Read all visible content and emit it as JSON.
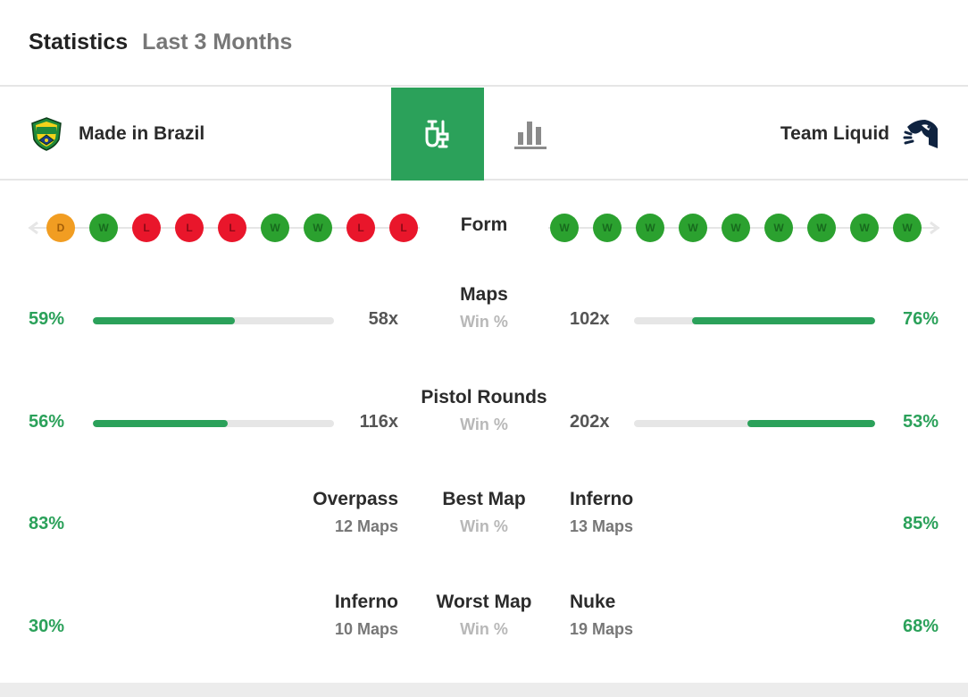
{
  "header": {
    "title": "Statistics",
    "subtitle": "Last 3 Months"
  },
  "teams": {
    "left": {
      "name": "Made in Brazil",
      "logo_icon": "mibr-shield-logo"
    },
    "right": {
      "name": "Team Liquid",
      "logo_icon": "liquid-horse-logo"
    }
  },
  "tabs": [
    {
      "icon": "compare-icon",
      "active": true
    },
    {
      "icon": "bar-chart-icon",
      "active": false
    }
  ],
  "form": {
    "label": "Form",
    "left": [
      "D",
      "W",
      "L",
      "L",
      "L",
      "W",
      "W",
      "L",
      "L"
    ],
    "right": [
      "W",
      "W",
      "W",
      "W",
      "W",
      "W",
      "W",
      "W",
      "W"
    ]
  },
  "stats": [
    {
      "label": "Maps",
      "sub": "Win %",
      "left_pct": "59%",
      "left_count": "58x",
      "left_value": 0.59,
      "right_pct": "76%",
      "right_count": "102x",
      "right_value": 0.76
    },
    {
      "label": "Pistol Rounds",
      "sub": "Win %",
      "left_pct": "56%",
      "left_count": "116x",
      "left_value": 0.56,
      "right_pct": "53%",
      "right_count": "202x",
      "right_value": 0.53
    }
  ],
  "maps": [
    {
      "label": "Best Map",
      "sub": "Win %",
      "left_pct": "83%",
      "left_map": "Overpass",
      "left_count": "12 Maps",
      "right_pct": "85%",
      "right_map": "Inferno",
      "right_count": "13 Maps"
    },
    {
      "label": "Worst Map",
      "sub": "Win %",
      "left_pct": "30%",
      "left_map": "Inferno",
      "left_count": "10 Maps",
      "right_pct": "68%",
      "right_map": "Nuke",
      "right_count": "19 Maps"
    }
  ],
  "colors": {
    "accent": "#2ba15a",
    "win": "#2ba12f",
    "loss": "#e9162b",
    "draw": "#f19d22",
    "track": "#e6e6e6"
  }
}
